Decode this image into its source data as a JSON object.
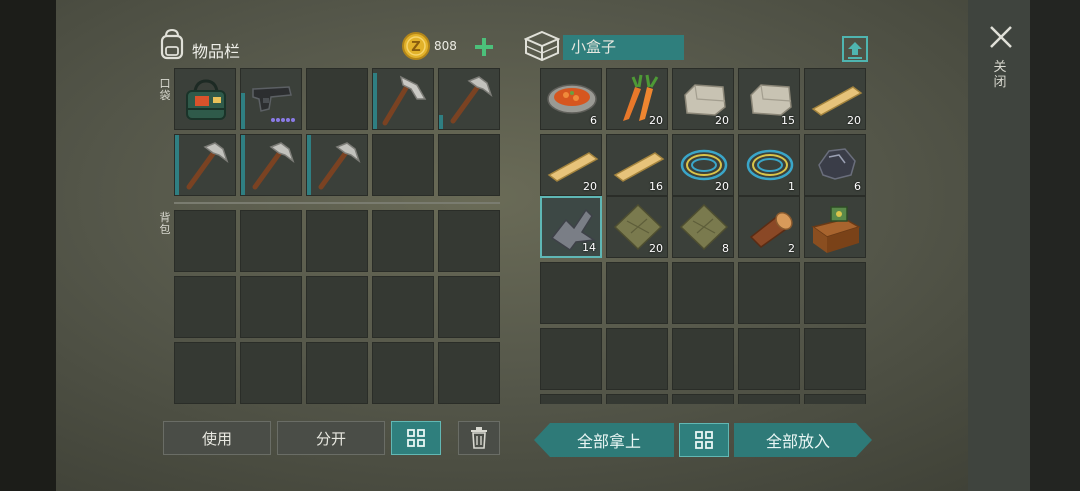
{
  "inventory": {
    "title": "物品栏",
    "coins": "808",
    "pocket_label": "口袋",
    "backpack_label": "背包"
  },
  "container": {
    "name": "小盒子",
    "close_label": "关闭"
  },
  "pocket_slots": [
    {
      "item": "medkit-bag",
      "count": ""
    },
    {
      "item": "pistol",
      "count": ""
    },
    {
      "item": "empty",
      "count": ""
    },
    {
      "item": "hatchet",
      "count": ""
    },
    {
      "item": "pickaxe",
      "count": ""
    },
    {
      "item": "pickaxe",
      "count": ""
    },
    {
      "item": "pickaxe",
      "count": ""
    },
    {
      "item": "pickaxe",
      "count": ""
    },
    {
      "item": "empty",
      "count": ""
    },
    {
      "item": "empty",
      "count": ""
    }
  ],
  "container_slots": [
    {
      "item": "stew-bowl",
      "count": "6"
    },
    {
      "item": "carrots",
      "count": "20"
    },
    {
      "item": "stone",
      "count": "20"
    },
    {
      "item": "stone",
      "count": "15"
    },
    {
      "item": "plank",
      "count": "20"
    },
    {
      "item": "plank",
      "count": "20"
    },
    {
      "item": "plank",
      "count": "16"
    },
    {
      "item": "wire",
      "count": "20"
    },
    {
      "item": "wire",
      "count": "1"
    },
    {
      "item": "iron-ore",
      "count": "6"
    },
    {
      "item": "scrap-metal",
      "count": "14"
    },
    {
      "item": "cloth",
      "count": "20"
    },
    {
      "item": "cloth",
      "count": "8"
    },
    {
      "item": "log",
      "count": "2"
    },
    {
      "item": "workbench",
      "count": ""
    }
  ],
  "buttons": {
    "use": "使用",
    "split": "分开",
    "take_all": "全部拿上",
    "put_all": "全部放入"
  },
  "colors": {
    "accent_teal": "#2f7f7d",
    "coin_gold": "#e2b22a",
    "plus_green": "#4cc07a"
  }
}
